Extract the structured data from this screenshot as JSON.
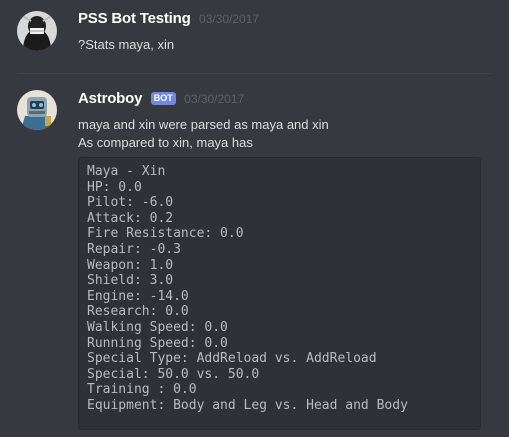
{
  "messages": [
    {
      "author": "PSS Bot Testing",
      "timestamp": "03/30/2017",
      "avatar_icon": "masked-user-avatar",
      "content": [
        "?Stats maya, xin"
      ]
    },
    {
      "author": "Astroboy",
      "bot_tag": "BOT",
      "timestamp": "03/30/2017",
      "avatar_icon": "robot-avatar",
      "content": [
        "maya and xin were parsed as maya and xin",
        "As compared to xin, maya has"
      ],
      "code_lines": [
        "Maya - Xin",
        "HP: 0.0",
        "Pilot: -6.0",
        "Attack: 0.2",
        "Fire Resistance: 0.0",
        "Repair: -0.3",
        "Weapon: 1.0",
        "Shield: 3.0",
        "Engine: -14.0",
        "Research: 0.0",
        "Walking Speed: 0.0",
        "Running Speed: 0.0",
        "Special Type: AddReload vs. AddReload",
        "Special: 50.0 vs. 50.0",
        "Training : 0.0",
        "Equipment: Body and Leg vs. Head and Body"
      ]
    }
  ],
  "colors": {
    "background": "#36393f",
    "username": "#ffffff",
    "timestamp": "#5e6167",
    "message_text": "#dcddde",
    "bot_tag": "#7289da",
    "code_background": "#2f3136",
    "code_text": "#b9bbbe"
  }
}
